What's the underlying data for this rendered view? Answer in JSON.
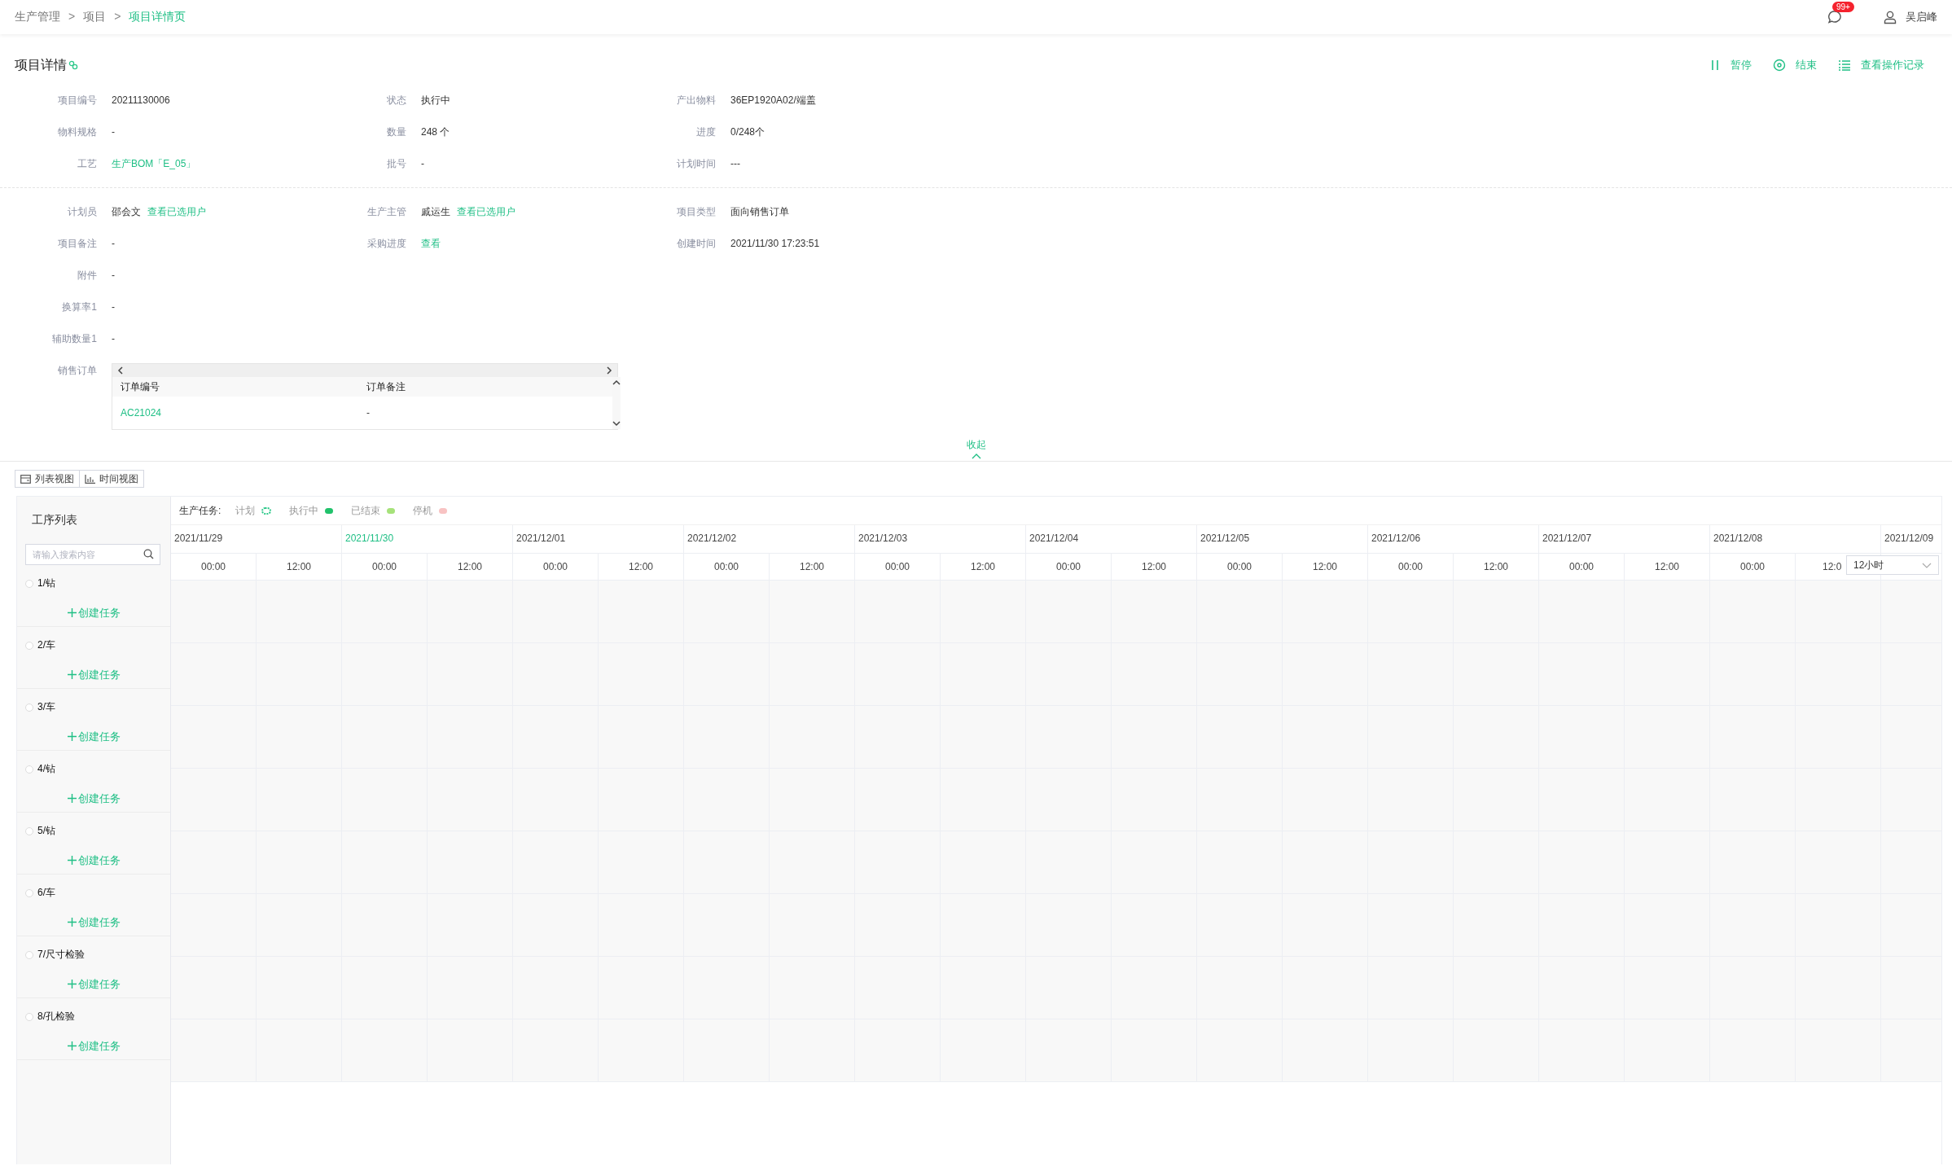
{
  "breadcrumb": {
    "separator": ">",
    "items": [
      {
        "label": "生产管理",
        "selected": false
      },
      {
        "label": "项目",
        "selected": false
      },
      {
        "label": "项目详情页",
        "selected": true
      }
    ]
  },
  "header": {
    "badge": "99+",
    "user": "吴启峰"
  },
  "title": "项目详情",
  "actions": [
    {
      "kind": "pause",
      "label": "暂停"
    },
    {
      "kind": "stop",
      "label": "结束"
    },
    {
      "kind": "log",
      "label": "查看操作记录"
    }
  ],
  "details_top": [
    {
      "label": "项目编号",
      "value": "20211130006"
    },
    {
      "label": "状态",
      "value": "执行中"
    },
    {
      "label": "产出物料",
      "value": "36EP1920A02/端盖"
    },
    {
      "label": "物料规格",
      "value": "-"
    },
    {
      "label": "数量",
      "value": "248 个"
    },
    {
      "label": "进度",
      "value": "0/248个"
    },
    {
      "label": "工艺",
      "link": "生产BOM「E_05」"
    },
    {
      "label": "批号",
      "value": "-"
    },
    {
      "label": "计划时间",
      "value": "---"
    }
  ],
  "details_bottom": [
    {
      "label": "计划员",
      "value": "邵会文",
      "link": "查看已选用户"
    },
    {
      "label": "生产主管",
      "value": "戚运生",
      "link": "查看已选用户"
    },
    {
      "label": "项目类型",
      "value": "面向销售订单"
    },
    {
      "label": "项目备注",
      "value": "-"
    },
    {
      "label": "采购进度",
      "link": "查看"
    },
    {
      "label": "创建时间",
      "value": "2021/11/30 17:23:51"
    },
    {
      "label": "附件",
      "value": "-"
    },
    {
      "label": "换算率1",
      "value": "-"
    },
    {
      "label": "辅助数量1",
      "value": "-"
    }
  ],
  "sales_orders": {
    "label": "销售订单",
    "columns": [
      "订单编号",
      "订单备注"
    ],
    "rows": [
      [
        "AC21024",
        "-"
      ]
    ]
  },
  "collapse": "收起",
  "view_tabs": [
    "列表视图",
    "时间视图"
  ],
  "sidebar": {
    "title": "工序列表",
    "search": {
      "placeholder": "请输入搜索内容"
    },
    "items": [
      {
        "name": "1/钻",
        "selected": false,
        "create": "创建任务"
      },
      {
        "name": "2/车",
        "selected": false,
        "create": "创建任务"
      },
      {
        "name": "3/车",
        "selected": false,
        "create": "创建任务"
      },
      {
        "name": "4/钻",
        "selected": false,
        "create": "创建任务"
      },
      {
        "name": "5/钻",
        "selected": false,
        "create": "创建任务"
      },
      {
        "name": "6/车",
        "selected": false,
        "create": "创建任务"
      },
      {
        "name": "7/尺寸检验",
        "selected": false,
        "create": "创建任务"
      },
      {
        "name": "8/孔检验",
        "selected": false,
        "create": "创建任务"
      }
    ]
  },
  "legend": {
    "title": "生产任务:",
    "items": [
      {
        "label": "计划",
        "kind": "outline",
        "color": "#2dc88a"
      },
      {
        "label": "执行中",
        "kind": "fill",
        "color": "#21c26b"
      },
      {
        "label": "已结束",
        "kind": "fill",
        "color": "#a6e27a"
      },
      {
        "label": "停机",
        "kind": "fill",
        "color": "#f8c3c3"
      }
    ]
  },
  "timeline": {
    "dates": [
      {
        "label": "2021/11/29",
        "today": false
      },
      {
        "label": "2021/11/30",
        "today": true
      },
      {
        "label": "2021/12/01",
        "today": false
      },
      {
        "label": "2021/12/02",
        "today": false
      },
      {
        "label": "2021/12/03",
        "today": false
      },
      {
        "label": "2021/12/04",
        "today": false
      },
      {
        "label": "2021/12/05",
        "today": false
      },
      {
        "label": "2021/12/06",
        "today": false
      },
      {
        "label": "2021/12/07",
        "today": false
      },
      {
        "label": "2021/12/08",
        "today": false
      },
      {
        "label": "2021/12/09",
        "today": false
      }
    ],
    "hours": [
      "00:00",
      "12:00",
      "00:00",
      "12:00",
      "00:00",
      "12:00",
      "00:00",
      "12:00",
      "00:00",
      "12:00",
      "00:00",
      "12:00",
      "00:00",
      "12:00",
      "00:00",
      "12:00",
      "00:00",
      "12:00",
      "00:00",
      "12:0"
    ],
    "scale": "12小时"
  }
}
